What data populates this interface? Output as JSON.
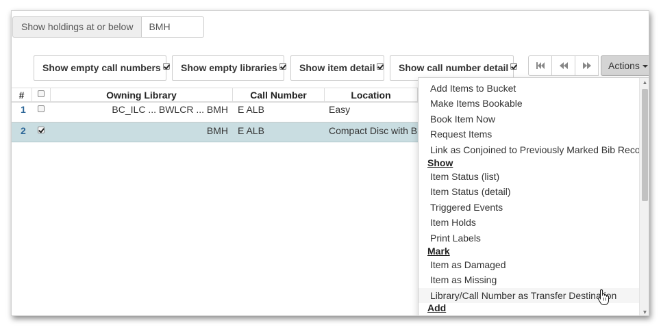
{
  "holdings": {
    "label": "Show holdings at or below",
    "value": "BMH"
  },
  "toggles": [
    {
      "label": "Show empty call numbers",
      "checked": true
    },
    {
      "label": "Show empty libraries",
      "checked": true
    },
    {
      "label": "Show item detail",
      "checked": true
    },
    {
      "label": "Show call number detail",
      "checked": true
    }
  ],
  "pager": {
    "first_icon": "skip-first-icon",
    "prev_icon": "rewind-icon",
    "next_icon": "fast-forward-icon"
  },
  "actions": {
    "label": "Actions"
  },
  "grid": {
    "columns": [
      "#",
      "",
      "Owning Library",
      "Call Number",
      "Location"
    ],
    "rows": [
      {
        "num": "1",
        "checked": false,
        "library": "BC_ILC ... BWLCR ... BMH",
        "call_number": "E ALB",
        "location": "Easy"
      },
      {
        "num": "2",
        "checked": true,
        "library": "BMH",
        "call_number": "E ALB",
        "location": "Compact Disc with B..."
      }
    ]
  },
  "menu": {
    "items_top": [
      "Add Items to Bucket",
      "Make Items Bookable",
      "Book Item Now",
      "Request Items",
      "Link as Conjoined to Previously Marked Bib Record"
    ],
    "show_header": "Show",
    "show_items": [
      "Item Status (list)",
      "Item Status (detail)",
      "Triggered Events",
      "Item Holds",
      "Print Labels"
    ],
    "mark_header": "Mark",
    "mark_items": [
      "Item as Damaged",
      "Item as Missing",
      "Library/Call Number as Transfer Destination"
    ],
    "add_header": "Add"
  },
  "colors": {
    "selected_row": "#c9dde1",
    "actions_button": "#d4d4d4",
    "row_number": "#2a6496"
  }
}
